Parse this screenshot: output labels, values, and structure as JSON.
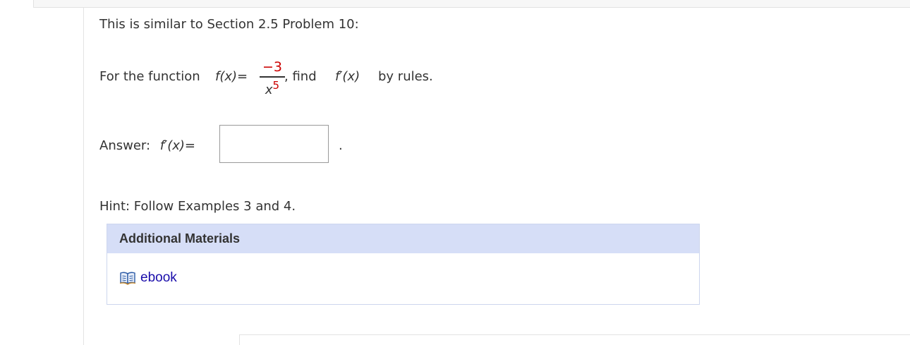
{
  "problem": {
    "intro": "This is similar to Section 2.5 Problem 10:",
    "question_prefix": "For the function",
    "function_name": "f(x)=",
    "numerator": "−3",
    "denominator_base": "x",
    "denominator_exponent": "5",
    "question_middle": ", find",
    "derivative_name": "f′(x)",
    "question_suffix": "by rules."
  },
  "answer": {
    "label": "Answer:",
    "derivative_name": "f′(x)=",
    "value": "",
    "period": "."
  },
  "hint": {
    "text": "Hint: Follow Examples 3 and 4."
  },
  "additional_materials": {
    "title": "Additional Materials",
    "items": [
      {
        "label": "ebook",
        "icon": "open-book-icon"
      }
    ]
  },
  "colors": {
    "accent_red": "#cc0000",
    "header_bg": "#d6def7",
    "link_blue": "#1a0dab"
  }
}
